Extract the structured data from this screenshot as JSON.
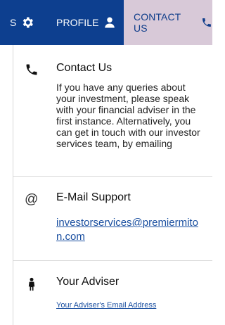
{
  "nav": {
    "settings_label": "S",
    "profile_label": "PROFILE",
    "contact_label": "CONTACT US"
  },
  "contact": {
    "heading": "Contact Us",
    "body": "If you have any queries about your investment, please speak with your financial adviser in the first instance. Alternatively, you can get in touch with our investor services team, by emailing"
  },
  "email_support": {
    "icon_text": "@",
    "heading": "E-Mail Support",
    "email": "investorservices@premiermiton.com"
  },
  "adviser": {
    "heading": "Your Adviser",
    "link": "Your Adviser's Email Address"
  }
}
